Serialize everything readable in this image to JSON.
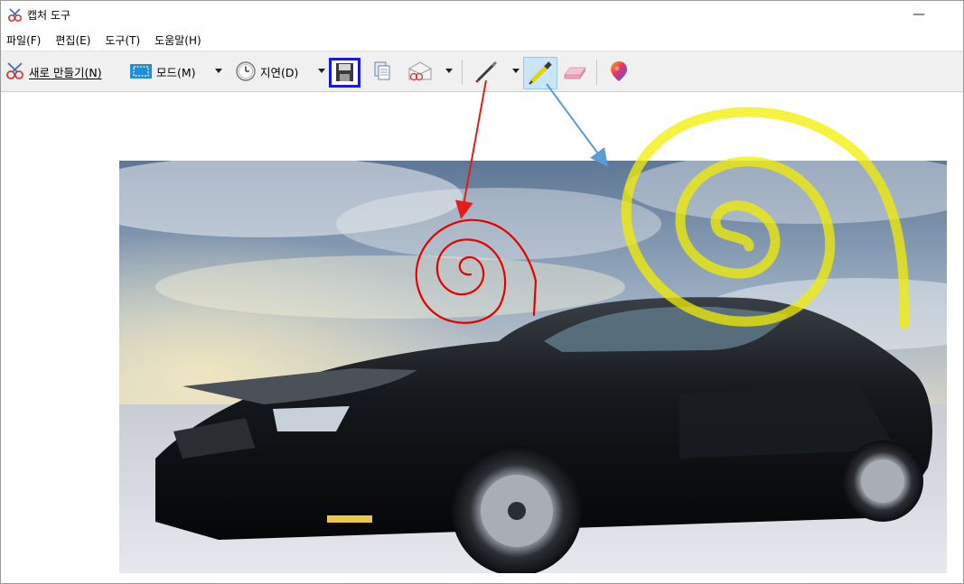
{
  "window": {
    "title": "캡처 도구",
    "minimize_glyph": "—"
  },
  "menu": {
    "items": [
      {
        "label": "파일(F)"
      },
      {
        "label": "편집(E)"
      },
      {
        "label": "도구(T)"
      },
      {
        "label": "도움말(H)"
      }
    ]
  },
  "toolbar": {
    "new_label": "새로 만들기(N)",
    "mode_label": "모드(M)",
    "delay_label": "지연(D)",
    "icons": [
      "scissors-icon",
      "mode-rectangle-icon",
      "clock-icon",
      "save-icon",
      "copy-icon",
      "send-email-icon",
      "pen-icon",
      "highlighter-icon",
      "eraser-icon",
      "paint3d-icon"
    ]
  },
  "annotations": {
    "red_arrow_color": "#e31b1b",
    "blue_arrow_color": "#5b9bd5",
    "pen_stroke_color": "#e60000",
    "highlighter_color": "#f2ee00",
    "save_highlight_color": "#1a1adc"
  },
  "canvas": {
    "image_subject": "car-photo"
  }
}
